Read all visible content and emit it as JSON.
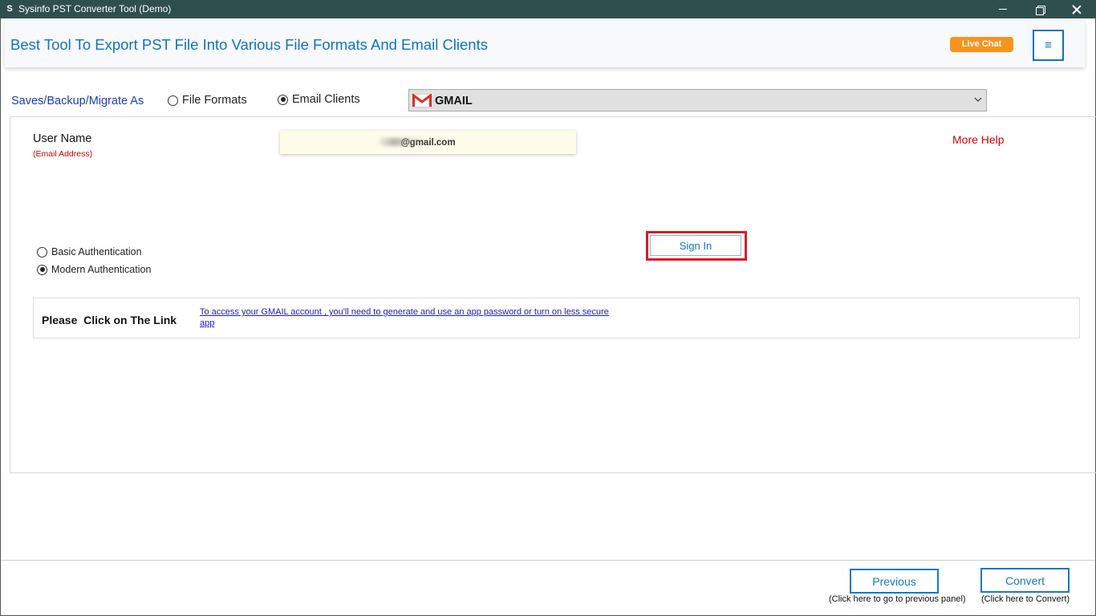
{
  "window": {
    "title": "Sysinfo PST Converter Tool (Demo)",
    "icon_letter": "S"
  },
  "header": {
    "title": "Best Tool To Export PST File Into Various File Formats And Email Clients",
    "live_chat_label": "Live Chat",
    "menu_glyph": "≡"
  },
  "saves_row": {
    "label": "Saves/Backup/Migrate As",
    "options": [
      {
        "label": "File Formats",
        "selected": false
      },
      {
        "label": "Email Clients",
        "selected": true
      }
    ],
    "client_select": {
      "value": "GMAIL",
      "icon": "gmail-icon"
    }
  },
  "login": {
    "user_name_label": "User Name",
    "user_name_hint": "(Email Address)",
    "email_value": "@gmail.com",
    "more_help": "More Help",
    "auth_options": [
      {
        "label": "Basic Authentication",
        "selected": false
      },
      {
        "label": "Modern Authentication",
        "selected": true
      }
    ],
    "sign_in_label": "Sign In"
  },
  "link_box": {
    "label": "Please  Click on The Link",
    "link_text": "To access your GMAIL account , you'll need to generate and use an app password or turn on less secure app"
  },
  "footer": {
    "previous_label": "Previous",
    "previous_hint": "(Click here to go to previous panel)",
    "convert_label": "Convert",
    "convert_hint": "(Click here to Convert)"
  },
  "colors": {
    "titlebar": "#2f4f4f",
    "brand_blue": "#0f73c4",
    "live_chat": "#f7941d",
    "highlight_red": "#d91b2b",
    "help_red": "#d60000"
  }
}
